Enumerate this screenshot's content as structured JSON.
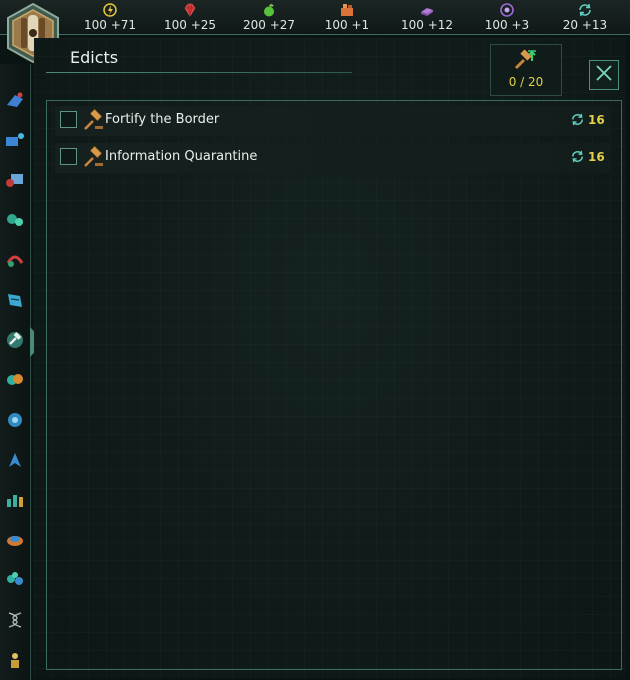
{
  "resources": [
    {
      "icon": "energy-icon",
      "value": "100 +71",
      "color": "#e8c53a"
    },
    {
      "icon": "minerals-icon",
      "value": "100 +25",
      "color": "#d23a3a"
    },
    {
      "icon": "food-icon",
      "value": "200 +27",
      "color": "#58c23b"
    },
    {
      "icon": "consumer-goods-icon",
      "value": "100 +1",
      "color": "#d9733a"
    },
    {
      "icon": "alloys-icon",
      "value": "100 +12",
      "color": "#b47ad8"
    },
    {
      "icon": "influence-icon",
      "value": "100 +3",
      "color": "#9b6ad6"
    },
    {
      "icon": "unity-icon",
      "value": "20 +13",
      "color": "#5fd0c0"
    }
  ],
  "panel": {
    "title": "Edicts",
    "edict_capacity": "0 / 20"
  },
  "edicts": [
    {
      "name": "Fortify the Border",
      "cost": "16"
    },
    {
      "name": "Information Quarantine",
      "cost": "16"
    }
  ],
  "sidebar": [
    "military-ships-icon",
    "planets-icon",
    "market-icon",
    "species-icon",
    "contacts-icon",
    "situation-log-icon",
    "edicts-icon",
    "factions-icon",
    "policies-icon",
    "fleets-icon",
    "planets-list-icon",
    "traditions-icon",
    "technology-icon",
    "genetics-icon",
    "leaders-icon"
  ],
  "accent": "#4a8f7f",
  "highlight": "#e3cf49"
}
